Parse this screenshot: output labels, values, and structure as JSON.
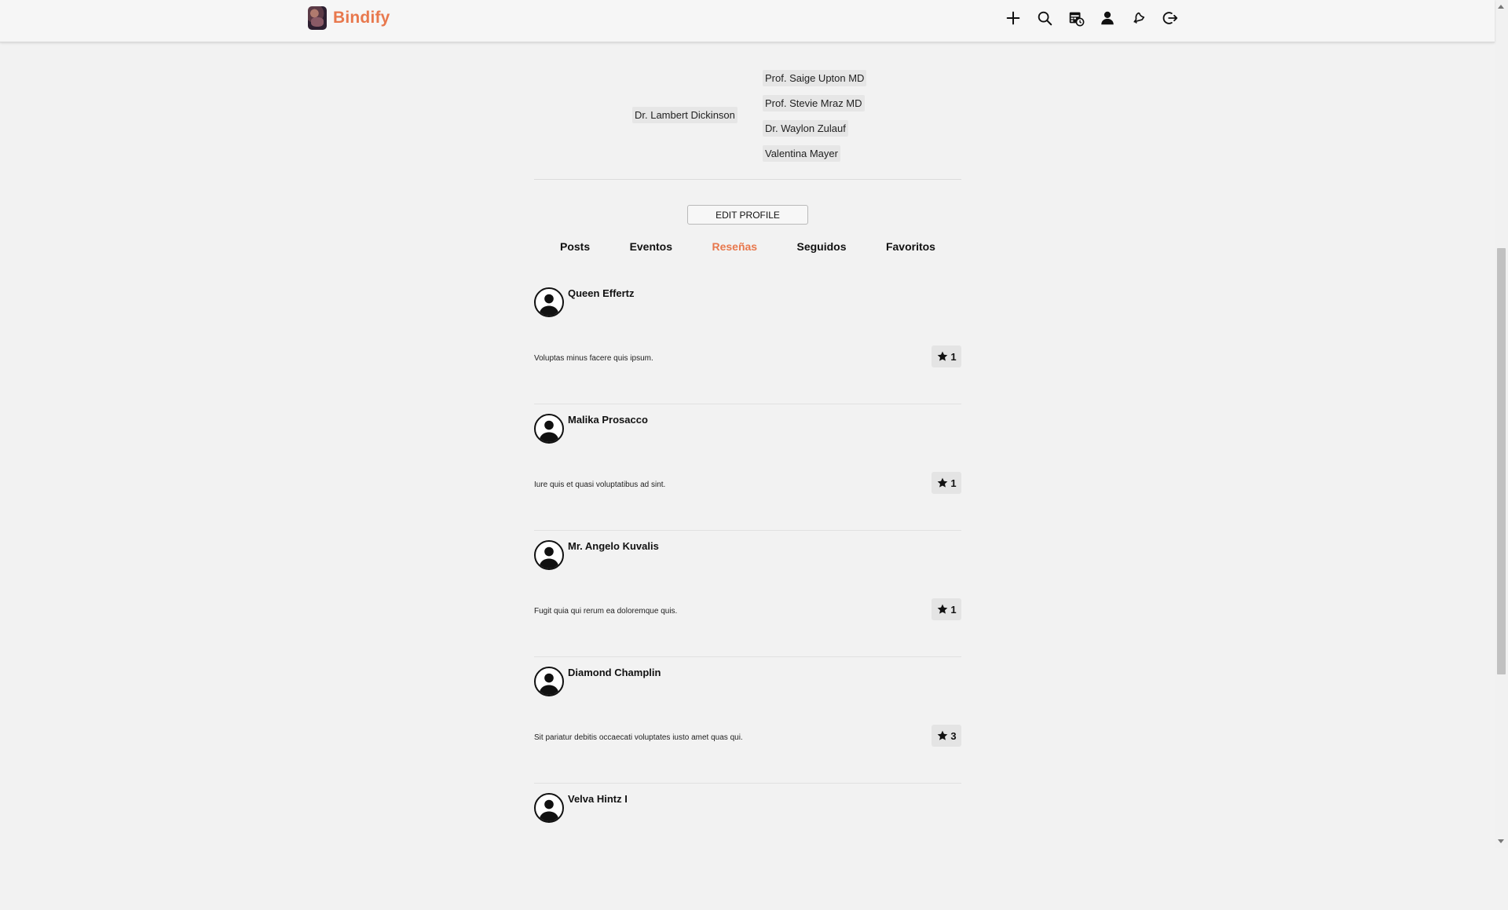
{
  "brand": {
    "name": "Bindify",
    "color": "#e8784d"
  },
  "nav": {
    "icons": [
      "plus-icon",
      "search-icon",
      "calendar-clock-icon",
      "user-icon",
      "notification-icon",
      "logout-icon"
    ]
  },
  "connections": {
    "left": [
      "Dr. Lambert Dickinson"
    ],
    "right": [
      "Prof. Saige Upton MD",
      "Prof. Stevie Mraz MD",
      "Dr. Waylon Zulauf",
      "Valentina Mayer"
    ]
  },
  "profile": {
    "edit_label": "EDIT PROFILE"
  },
  "tabs": [
    {
      "label": "Posts"
    },
    {
      "label": "Eventos"
    },
    {
      "label": "Reseñas",
      "active": true
    },
    {
      "label": "Seguidos"
    },
    {
      "label": "Favoritos"
    }
  ],
  "reviews": [
    {
      "author": "Queen Effertz",
      "text": "Voluptas minus facere quis ipsum.",
      "rating": "1"
    },
    {
      "author": "Malika Prosacco",
      "text": "Iure quis et quasi voluptatibus ad sint.",
      "rating": "1"
    },
    {
      "author": "Mr. Angelo Kuvalis",
      "text": "Fugit quia qui rerum ea doloremque quis.",
      "rating": "1"
    },
    {
      "author": "Diamond Champlin",
      "text": "Sit pariatur debitis occaecati voluptates iusto amet quas qui.",
      "rating": "3"
    },
    {
      "author": "Velva Hintz I",
      "text": "",
      "rating": ""
    }
  ]
}
